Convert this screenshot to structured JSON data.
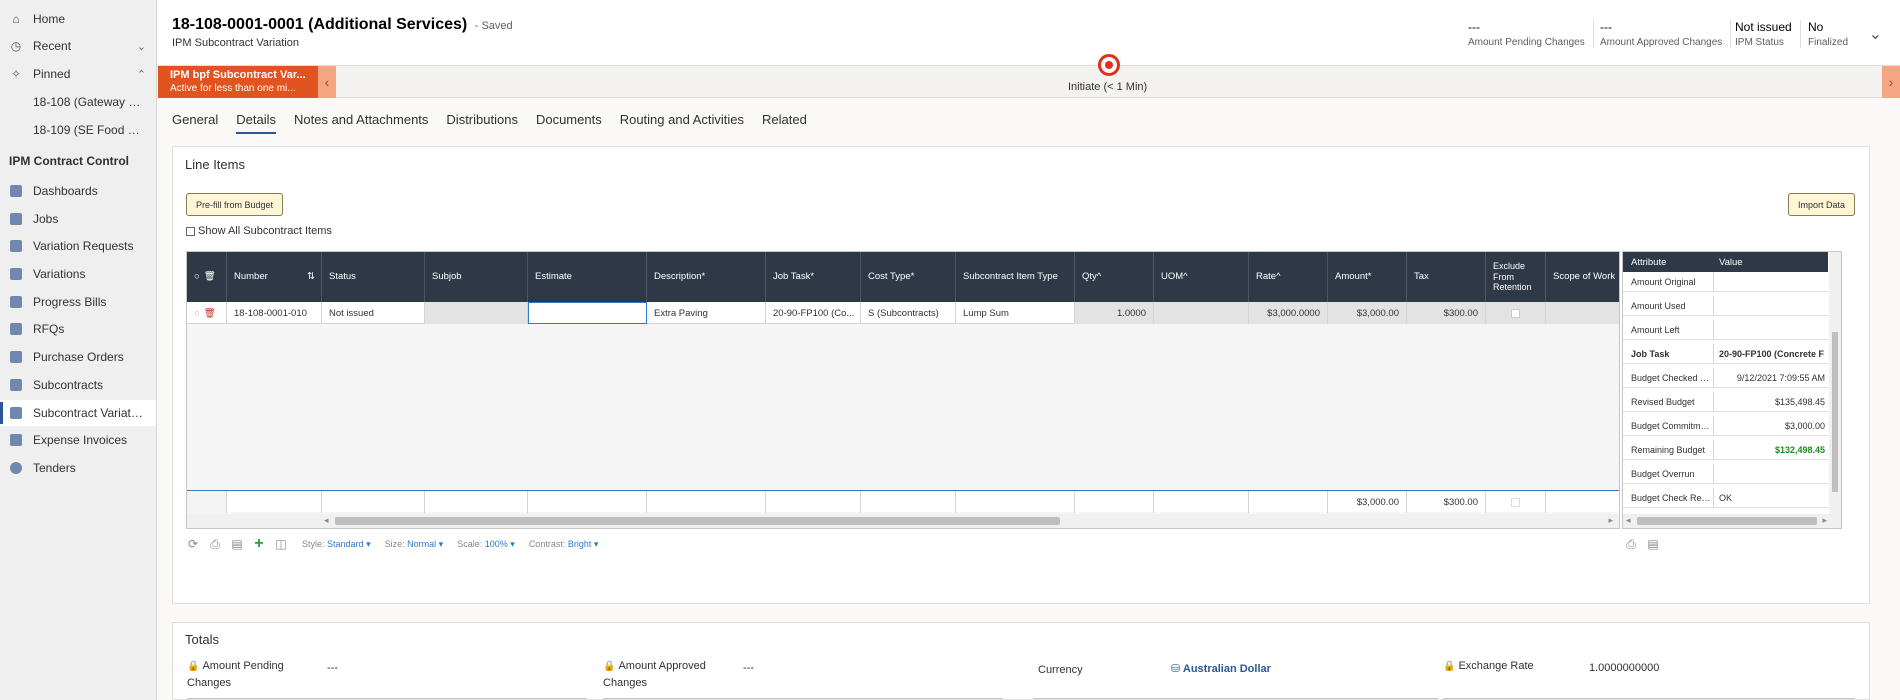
{
  "sidebar": {
    "home": "Home",
    "recent": "Recent",
    "pinned": "Pinned",
    "pinned_items": [
      "18-108 (Gateway Wi...",
      "18-109 (SE Food War..."
    ],
    "section": "IPM Contract Control",
    "items": [
      {
        "label": "Dashboards",
        "icon": "dashboard-icon"
      },
      {
        "label": "Jobs",
        "icon": "jobs-icon"
      },
      {
        "label": "Variation Requests",
        "icon": "variation-requests-icon"
      },
      {
        "label": "Variations",
        "icon": "variations-icon"
      },
      {
        "label": "Progress Bills",
        "icon": "progress-bills-icon"
      },
      {
        "label": "RFQs",
        "icon": "rfqs-icon"
      },
      {
        "label": "Purchase Orders",
        "icon": "purchase-orders-icon"
      },
      {
        "label": "Subcontracts",
        "icon": "subcontracts-icon"
      },
      {
        "label": "Subcontract Variations",
        "icon": "subcontract-variations-icon"
      },
      {
        "label": "Expense Invoices",
        "icon": "expense-invoices-icon"
      },
      {
        "label": "Tenders",
        "icon": "tenders-icon"
      }
    ]
  },
  "header": {
    "title": "18-108-0001-0001 (Additional Services)",
    "saved": "- Saved",
    "entity": "IPM Subcontract Variation",
    "fields": [
      {
        "value": "---",
        "label": "Amount Pending Changes"
      },
      {
        "value": "---",
        "label": "Amount Approved Changes"
      },
      {
        "value": "Not issued",
        "label": "IPM Status"
      },
      {
        "value": "No",
        "label": "Finalized"
      }
    ]
  },
  "bpf": {
    "stage_title": "IPM bpf Subcontract Var...",
    "stage_sub": "Active for less than one mi...",
    "current": "Initiate",
    "duration": "(< 1 Min)"
  },
  "tabs": [
    "General",
    "Details",
    "Notes and Attachments",
    "Distributions",
    "Documents",
    "Routing and Activities",
    "Related"
  ],
  "line_items": {
    "title": "Line Items",
    "prefill_label": "Pre-fill from Budget",
    "import_label": "Import Data",
    "show_all_label": "Show All Subcontract Items",
    "columns": [
      "Number",
      "Status",
      "Subjob",
      "Estimate",
      "Description*",
      "Job Task*",
      "Cost Type*",
      "Subcontract Item Type",
      "Qty^",
      "UOM^",
      "Rate^",
      "Amount*",
      "Tax",
      "Exclude From Retention",
      "Scope of Work"
    ],
    "row": {
      "number": "18-108-0001-010",
      "status": "Not issued",
      "subjob": "",
      "estimate": "",
      "description": "Extra Paving",
      "job_task": "20-90-FP100 (Co...",
      "cost_type": "S (Subcontracts)",
      "item_type": "Lump Sum",
      "qty": "1.0000",
      "uom": "",
      "rate": "$3,000.0000",
      "amount": "$3,000.00",
      "tax": "$300.00"
    },
    "footer": {
      "amount": "$3,000.00",
      "tax": "$300.00"
    }
  },
  "toolbar": {
    "style_label": "Style:",
    "style_value": "Standard",
    "size_label": "Size:",
    "size_value": "Normal",
    "scale_label": "Scale:",
    "scale_value": "100%",
    "contrast_label": "Contrast:",
    "contrast_value": "Bright"
  },
  "attributes": {
    "col_attr": "Attribute",
    "col_value": "Value",
    "rows": [
      {
        "attr": "Amount Original",
        "value": ""
      },
      {
        "attr": "Amount Used",
        "value": ""
      },
      {
        "attr": "Amount Left",
        "value": ""
      },
      {
        "attr": "Job Task",
        "value": "20-90-FP100 (Concrete F"
      },
      {
        "attr": "Budget Checked On",
        "value": "9/12/2021 7:09:55 AM"
      },
      {
        "attr": "Revised Budget",
        "value": "$135,498.45"
      },
      {
        "attr": "Budget Commitme...",
        "value": "$3,000.00"
      },
      {
        "attr": "Remaining Budget",
        "value": "$132,498.45"
      },
      {
        "attr": "Budget Overrun",
        "value": ""
      },
      {
        "attr": "Budget Check Result",
        "value": "OK"
      }
    ],
    "green": "#1e8c1e"
  },
  "totals": {
    "title": "Totals",
    "pending_label": "Amount Pending Changes",
    "pending_value": "---",
    "approved_label": "Amount Approved Changes",
    "approved_value": "---",
    "currency_label": "Currency",
    "currency_value": "Australian Dollar",
    "rate_label": "Exchange Rate",
    "rate_value": "1.0000000000"
  },
  "colors": {
    "accent": "#2b579a",
    "bpf_active": "#e1541f",
    "grid_header": "#2f3847",
    "link": "#2b79d0"
  }
}
